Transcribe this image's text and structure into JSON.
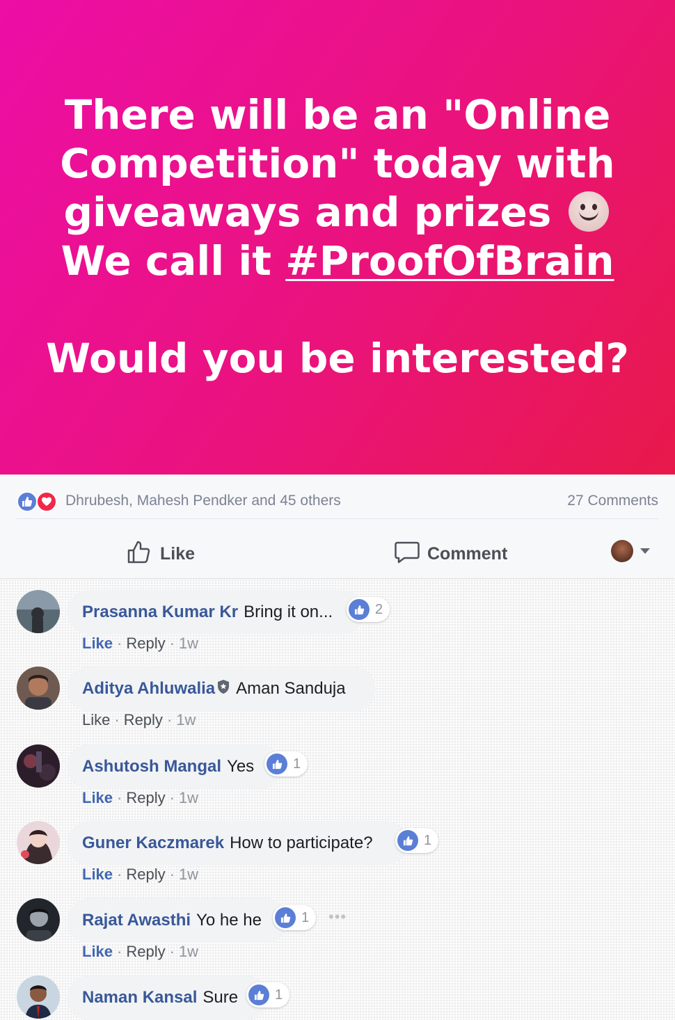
{
  "banner": {
    "line_1": "There will be an \"Online Competition\" today with giveaways and prizes",
    "line_2": "We call it",
    "hashtag": "#ProofOfBrain",
    "question": "Would you be interested?"
  },
  "reactions": {
    "icons": [
      "like-reaction-icon",
      "love-reaction-icon"
    ],
    "names": "Dhrubesh, Mahesh Pendker and 45 others",
    "comments_count": "27 Comments"
  },
  "actions": {
    "like_label": "Like",
    "comment_label": "Comment"
  },
  "colors": {
    "banner_start": "#ec0ea6",
    "banner_end": "#e8194a",
    "link_blue": "#4267b2",
    "like_blue": "#5b7fd6",
    "love_red": "#f0284a"
  },
  "comments": [
    {
      "author": "Prasanna Kumar Kr",
      "text": "Bring it on...",
      "likes": "2",
      "like_label": "Like",
      "reply_label": "Reply",
      "time": "1w"
    },
    {
      "author": "Aditya Ahluwalia",
      "text": "Aman Sanduja",
      "likes": "",
      "like_label": "Like",
      "reply_label": "Reply",
      "time": "1w"
    },
    {
      "author": "Ashutosh Mangal",
      "text": "Yes",
      "likes": "1",
      "like_label": "Like",
      "reply_label": "Reply",
      "time": "1w"
    },
    {
      "author": "Guner Kaczmarek",
      "text": "How to participate?",
      "likes": "1",
      "like_label": "Like",
      "reply_label": "Reply",
      "time": "1w"
    },
    {
      "author": "Rajat Awasthi",
      "text": "Yo he he",
      "likes": "1",
      "like_label": "Like",
      "reply_label": "Reply",
      "time": "1w"
    },
    {
      "author": "Naman Kansal",
      "text": "Sure",
      "likes": "1"
    }
  ],
  "meta_separator": "·",
  "more_options": "•••"
}
